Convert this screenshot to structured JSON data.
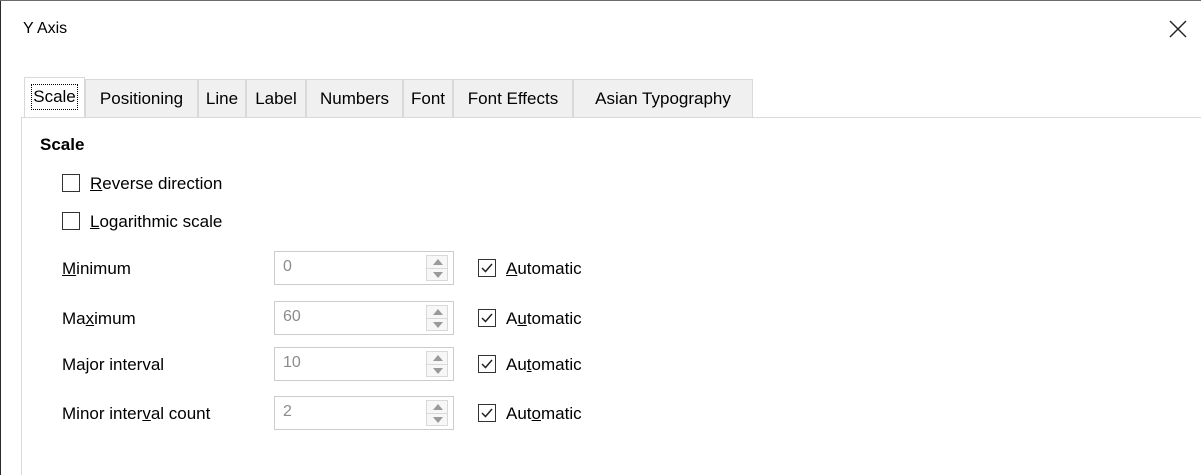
{
  "window": {
    "title": "Y Axis",
    "close_icon": "close-icon"
  },
  "tabs": [
    {
      "label": "Scale",
      "active": true
    },
    {
      "label": "Positioning"
    },
    {
      "label": "Line"
    },
    {
      "label": "Label"
    },
    {
      "label": "Numbers"
    },
    {
      "label": "Font"
    },
    {
      "label": "Font Effects"
    },
    {
      "label": "Asian Typography"
    }
  ],
  "scale": {
    "heading": "Scale",
    "reverse_direction": {
      "mnemonic": "R",
      "rest": "everse direction",
      "checked": false
    },
    "logarithmic_scale": {
      "mnemonic": "L",
      "rest": "ogarithmic scale",
      "checked": false
    },
    "rows": [
      {
        "pre": "",
        "mnemonic": "M",
        "post": "inimum",
        "value": "0",
        "auto": {
          "pre": "",
          "mnemonic": "A",
          "post": "utomatic",
          "checked": true
        }
      },
      {
        "pre": "Ma",
        "mnemonic": "x",
        "post": "imum",
        "value": "60",
        "auto": {
          "pre": "A",
          "mnemonic": "u",
          "post": "tomatic",
          "checked": true
        }
      },
      {
        "pre": "Ma",
        "mnemonic": "j",
        "post": "or interval",
        "value": "10",
        "auto": {
          "pre": "Au",
          "mnemonic": "t",
          "post": "omatic",
          "checked": true
        }
      },
      {
        "pre": "Minor inter",
        "mnemonic": "v",
        "post": "al count",
        "value": "2",
        "auto": {
          "pre": "Aut",
          "mnemonic": "o",
          "post": "matic",
          "checked": true
        }
      }
    ]
  }
}
